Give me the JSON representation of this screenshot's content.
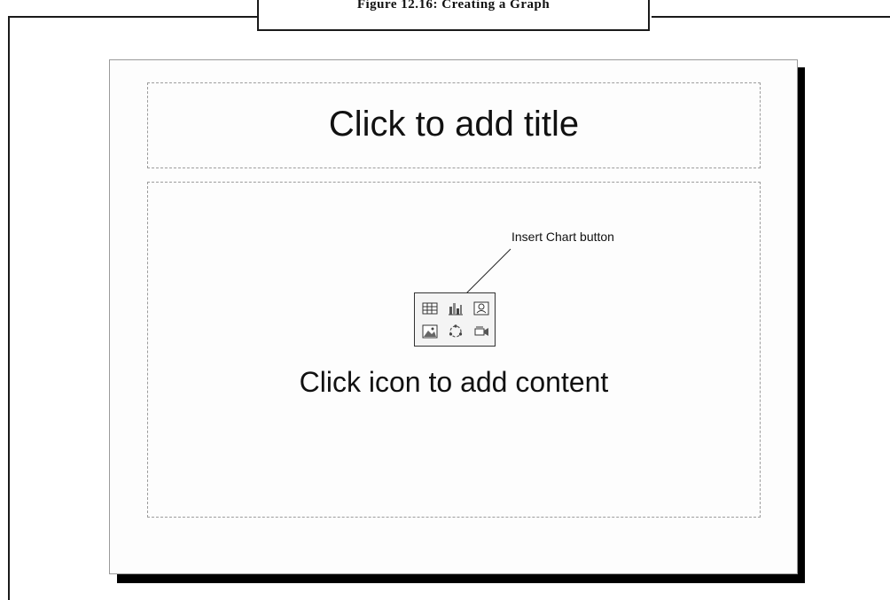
{
  "figure": {
    "caption": "Figure 12.16: Creating a Graph"
  },
  "slide": {
    "title_placeholder": "Click to add title",
    "content_placeholder": "Click icon to add content",
    "callout_label": "Insert Chart button",
    "content_icons": [
      {
        "name": "insert-table-icon"
      },
      {
        "name": "insert-chart-icon"
      },
      {
        "name": "insert-clip-art-icon"
      },
      {
        "name": "insert-picture-icon"
      },
      {
        "name": "insert-diagram-icon"
      },
      {
        "name": "insert-media-clip-icon"
      }
    ]
  }
}
